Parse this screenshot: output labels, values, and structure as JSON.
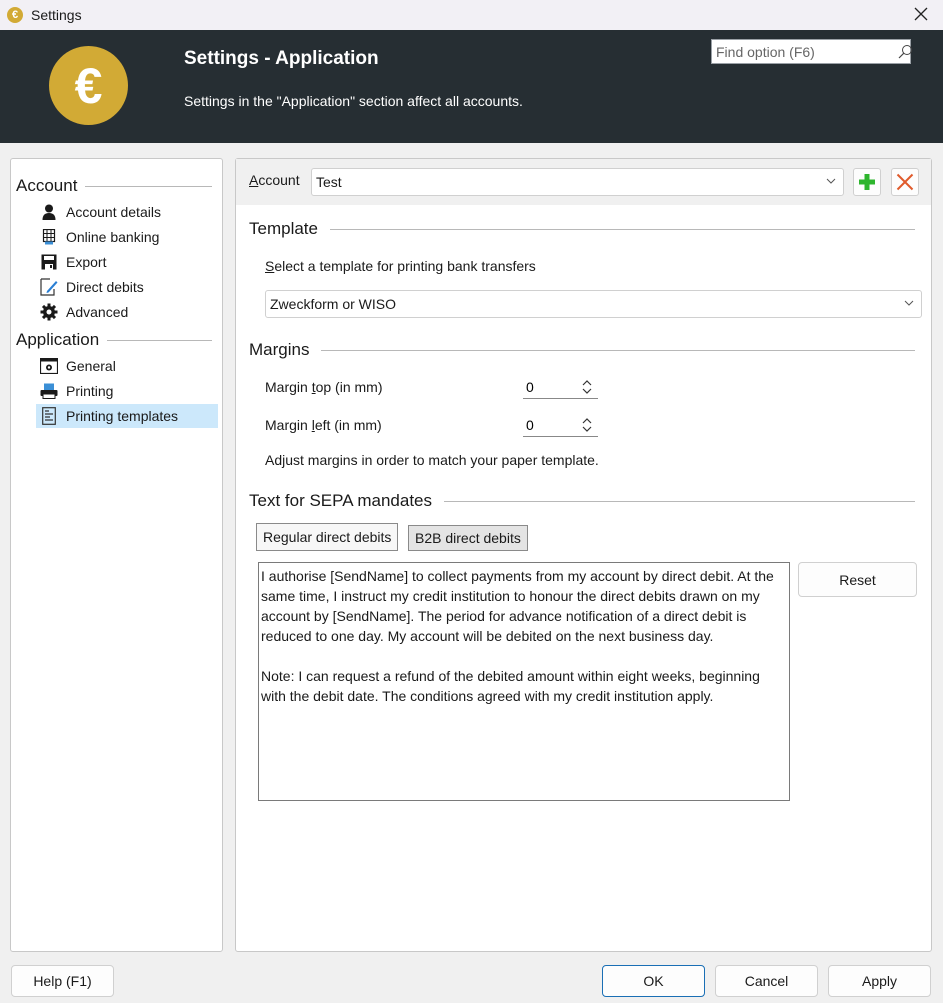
{
  "window": {
    "title": "Settings",
    "app_icon_glyph": "€",
    "close_glyph": "✕"
  },
  "header": {
    "title": "Settings - Application",
    "subtitle": "Settings in the \"Application\" section affect all accounts.",
    "logo_glyph": "€",
    "search_placeholder": "Find option (F6)",
    "search_value": "",
    "accent_color": "#d2aa35",
    "background_color": "#262e33"
  },
  "sidebar": {
    "groups": [
      {
        "label": "Account",
        "items": [
          {
            "label": "Account details",
            "icon": "person-icon"
          },
          {
            "label": "Online banking",
            "icon": "keypad-icon"
          },
          {
            "label": "Export",
            "icon": "floppy-disk-icon"
          },
          {
            "label": "Direct debits",
            "icon": "document-pen-icon"
          },
          {
            "label": "Advanced",
            "icon": "gear-icon"
          }
        ]
      },
      {
        "label": "Application",
        "items": [
          {
            "label": "General",
            "icon": "window-gear-icon"
          },
          {
            "label": "Printing",
            "icon": "printer-icon"
          },
          {
            "label": "Printing templates",
            "icon": "template-document-icon",
            "selected": true
          }
        ]
      }
    ]
  },
  "account_bar": {
    "label_prefix_underlined": "A",
    "label_rest": "ccount",
    "selected_account": "Test",
    "add_button_color": "#2db52d",
    "delete_button_color": "#e05a2b"
  },
  "template_section": {
    "heading": "Template",
    "prompt_underlined": "S",
    "prompt_rest": "elect a template for printing bank transfers",
    "selected_template": "Zweckform or WISO"
  },
  "margins_section": {
    "heading": "Margins",
    "top": {
      "label_before": "Margin ",
      "label_underlined": "t",
      "label_after": "op (in mm)",
      "value": "0"
    },
    "left": {
      "label_before": "Margin ",
      "label_underlined": "l",
      "label_after": "eft (in mm)",
      "value": "0"
    },
    "hint": "Adjust margins in order to match your paper template."
  },
  "sepa_section": {
    "heading": "Text for SEPA mandates",
    "tabs": [
      {
        "label": "Regular direct debits",
        "active": true
      },
      {
        "label": "B2B direct debits",
        "active": false
      }
    ],
    "mandate_text": "I authorise [SendName] to collect payments from my account by direct debit. At the same time, I instruct my credit institution to honour the direct debits drawn on my account by [SendName]. The period for advance notification of a direct debit is reduced to one day. My account will be debited on the next business day.\n\nNote: I can request a refund of the debited amount within eight weeks, beginning with the debit date. The conditions agreed with my credit institution apply.",
    "reset_label": "Reset"
  },
  "footer": {
    "help_label": "Help (F1)",
    "ok_label": "OK",
    "cancel_label": "Cancel",
    "apply_label": "Apply"
  }
}
